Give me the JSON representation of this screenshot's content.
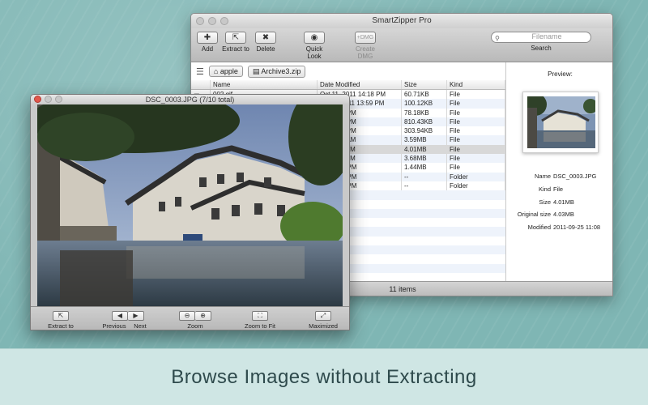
{
  "main_window": {
    "title": "SmartZipper Pro",
    "toolbar": [
      {
        "label": "Add",
        "icon": "plus-icon",
        "glyph": "✚"
      },
      {
        "label": "Extract to",
        "icon": "extract-icon",
        "glyph": "⇱"
      },
      {
        "label": "Delete",
        "icon": "delete-icon",
        "glyph": "✖"
      },
      {
        "label": "Quick Look",
        "icon": "eye-icon",
        "glyph": "◉"
      },
      {
        "label": "Create DMG",
        "icon": "dmg-icon",
        "glyph": "+DMG"
      }
    ],
    "search": {
      "placeholder": "Filename",
      "label": "Search"
    },
    "path": [
      "apple",
      "Archive3.zip"
    ],
    "columns": [
      "Name",
      "Date Modified",
      "Size",
      "Kind"
    ],
    "files": [
      {
        "name": "002.gif",
        "date": "Oct 11, 2011 14:18 PM",
        "size": "60.71KB",
        "kind": "File"
      },
      {
        "name": "01.JPG",
        "date": "Jul 14, 2011 13:59 PM",
        "size": "100.12KB",
        "kind": "File"
      },
      {
        "name": "",
        "date": "11 13:43 PM",
        "size": "78.18KB",
        "kind": "File"
      },
      {
        "name": "",
        "date": "11 15:15 PM",
        "size": "810.43KB",
        "kind": "File"
      },
      {
        "name": "",
        "date": "11 14:49 PM",
        "size": "303.94KB",
        "kind": "File"
      },
      {
        "name": "",
        "date": "11 10:28 AM",
        "size": "3.59MB",
        "kind": "File"
      },
      {
        "name": "",
        "date": "11 11:08 AM",
        "size": "4.01MB",
        "kind": "File"
      },
      {
        "name": "",
        "date": "11 11:10 AM",
        "size": "3.68MB",
        "kind": "File"
      },
      {
        "name": "",
        "date": "12 15:25 PM",
        "size": "1.44MB",
        "kind": "File"
      },
      {
        "name": "",
        "date": "12 15:08 PM",
        "size": "--",
        "kind": "Folder"
      },
      {
        "name": "",
        "date": "12 15:08 PM",
        "size": "--",
        "kind": "Folder"
      }
    ],
    "preview": {
      "title": "Preview:",
      "info": [
        {
          "key": "Name",
          "value": "DSC_0003.JPG"
        },
        {
          "key": "Kind",
          "value": "File"
        },
        {
          "key": "Size",
          "value": "4.01MB"
        },
        {
          "key": "Original size",
          "value": "4.03MB"
        },
        {
          "key": "Modified",
          "value": "2011-09-25 11:08"
        }
      ]
    },
    "status": "11 items"
  },
  "viewer_window": {
    "title": "DSC_0003.JPG  (7/10 total)",
    "controls": [
      {
        "label": "Extract to",
        "glyphs": [
          "⇱"
        ]
      },
      {
        "label": "Previous",
        "glyphs": [
          "◀"
        ]
      },
      {
        "label": "Next",
        "glyphs": [
          "▶"
        ]
      },
      {
        "label": "Zoom",
        "glyphs": [
          "⊖",
          "⊕"
        ]
      },
      {
        "label": "Zoom to Fit",
        "glyphs": [
          "⛶"
        ]
      },
      {
        "label": "Maximized",
        "glyphs": [
          "⤢"
        ]
      }
    ]
  },
  "caption": "Browse Images without Extracting"
}
